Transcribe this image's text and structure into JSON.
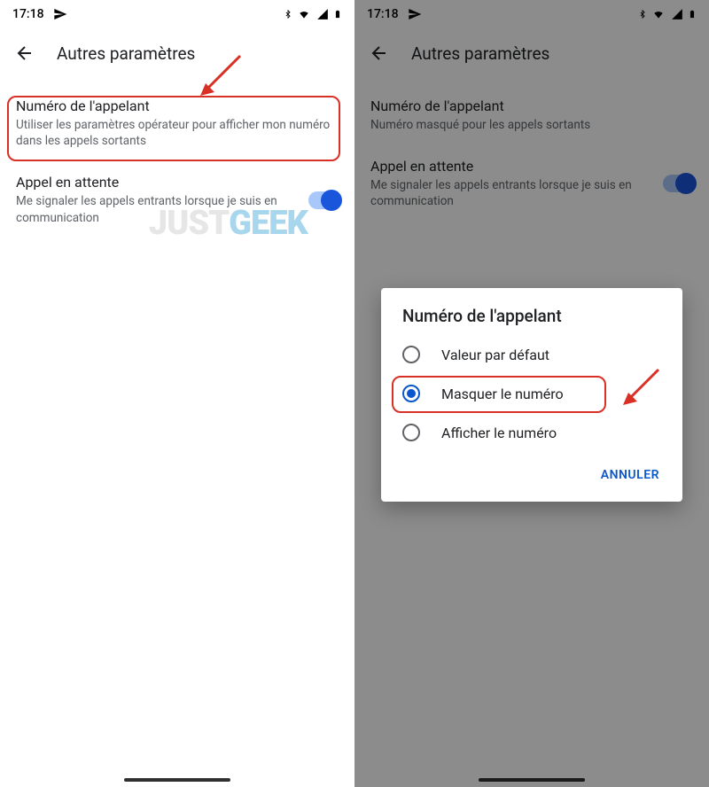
{
  "status": {
    "time": "17:18",
    "icons": {
      "send": "send-icon",
      "bluetooth": "bluetooth-icon",
      "wifi": "wifi-icon",
      "signal": "signal-icon",
      "battery": "battery-icon"
    }
  },
  "header": {
    "title": "Autres paramètres"
  },
  "settings": {
    "callerId": {
      "title": "Numéro de l'appelant",
      "subtitleLeft": "Utiliser les paramètres opérateur pour afficher mon numéro dans les appels sortants",
      "subtitleRight": "Numéro masqué pour les appels sortants"
    },
    "callWaiting": {
      "title": "Appel en attente",
      "subtitle": "Me signaler les appels entrants lorsque je suis en communication"
    }
  },
  "dialog": {
    "title": "Numéro de l'appelant",
    "options": [
      {
        "label": "Valeur par défaut",
        "selected": false
      },
      {
        "label": "Masquer le numéro",
        "selected": true
      },
      {
        "label": "Afficher le numéro",
        "selected": false
      }
    ],
    "cancel": "ANNULER"
  },
  "watermark": {
    "part1": "JUST",
    "part2": "GEEK"
  },
  "colors": {
    "accent": "#1a56db",
    "highlight": "#d93025",
    "link": "#0b57d0"
  }
}
